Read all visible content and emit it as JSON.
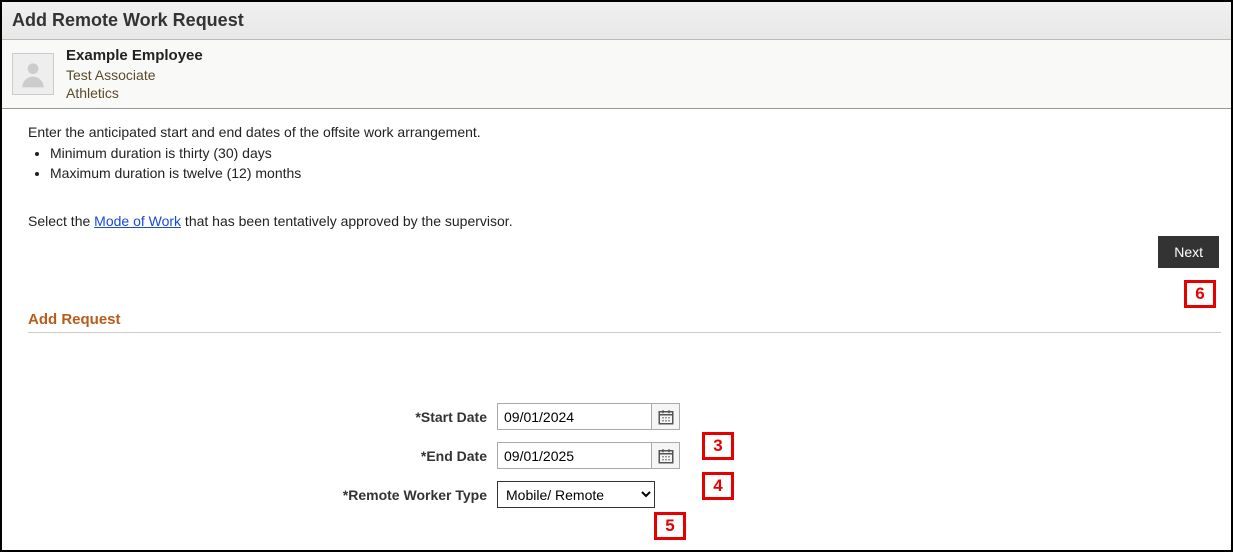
{
  "header": {
    "title": "Add Remote Work Request"
  },
  "employee": {
    "name": "Example Employee",
    "title": "Test Associate",
    "department": "Athletics"
  },
  "instructions": {
    "intro": "Enter the anticipated start and end dates of the offsite work arrangement.",
    "bullet1": "Minimum duration is thirty (30) days",
    "bullet2": "Maximum duration is twelve (12) months",
    "mode_prefix": "Select the ",
    "mode_link": "Mode of Work",
    "mode_suffix": " that has been tentatively approved by the supervisor."
  },
  "buttons": {
    "next": "Next"
  },
  "section": {
    "add_request": "Add Request"
  },
  "form": {
    "start_date": {
      "label": "*Start Date",
      "value": "09/01/2024"
    },
    "end_date": {
      "label": "*End Date",
      "value": "09/01/2025"
    },
    "worker_type": {
      "label": "*Remote Worker Type",
      "selected": "Mobile/ Remote"
    }
  },
  "callouts": {
    "c3": "3",
    "c4": "4",
    "c5": "5",
    "c6": "6"
  }
}
